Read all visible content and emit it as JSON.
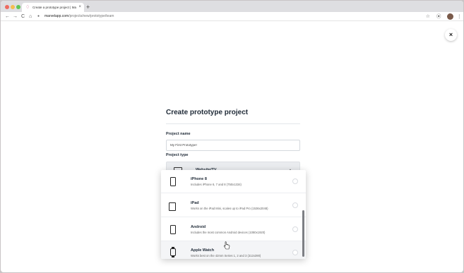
{
  "browser": {
    "tab_title": "Create a prototype project | Ma",
    "tab_favicon": "marvel-logo-icon",
    "tab_close": "×",
    "new_tab": "+",
    "url_host": "marvelapp.com",
    "url_path": "/projects/new/prototype/team",
    "back": "←",
    "forward": "→",
    "reload": "C",
    "home": "⌂",
    "lock": "🔒",
    "star": "☆",
    "extension": "⦿",
    "menu": "⋮",
    "traffic_light_colors": [
      "#ee6a5f",
      "#f5be4f",
      "#62c655"
    ]
  },
  "modal": {
    "close_symbol": "×",
    "title": "Create prototype project",
    "name_label": "Project name",
    "name_value": "My First Prototype!",
    "type_label": "Project type",
    "selected_type": "Website/TV",
    "chevron": "▲",
    "options": [
      {
        "title": "iPhone 8",
        "description": "Includes iPhone 6, 7 and 8 (750x1334)",
        "icon": "phone-icon"
      },
      {
        "title": "iPad",
        "description": "Works on the iPad Mini, scales up to iPad Pro (1536x2048)",
        "icon": "tablet-icon"
      },
      {
        "title": "Android",
        "description": "Includes the most common Android devices (1080x1920)",
        "icon": "android-phone-icon"
      },
      {
        "title": "Apple Watch",
        "description": "Works best on the 42mm Series 1, 2 and 3 (312x390)",
        "icon": "watch-icon"
      }
    ]
  }
}
